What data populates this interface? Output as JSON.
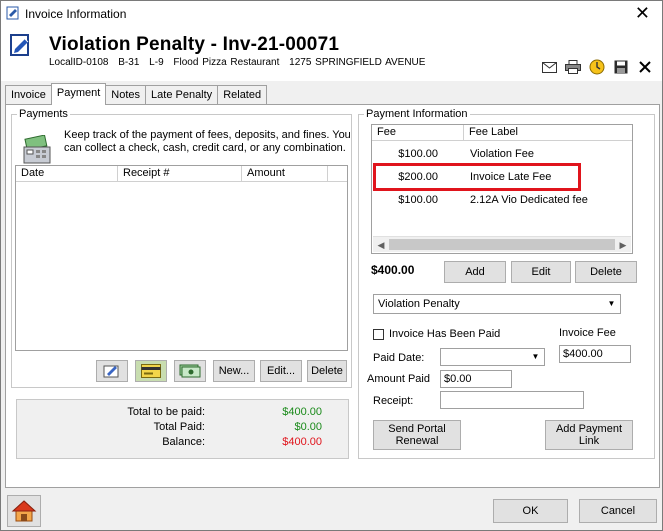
{
  "window": {
    "title": "Invoice Information",
    "close_glyph": "✕"
  },
  "header": {
    "title": "Violation Penalty - Inv-21-00071",
    "local_id": "LocalID-0108",
    "code1": "B-31",
    "code2": "L-9",
    "business": "Flood Pizza Restaurant",
    "address": "1275 SPRINGFIELD AVENUE",
    "icons": [
      "envelope-icon",
      "printer-icon",
      "clock-icon",
      "save-icon",
      "close-icon"
    ]
  },
  "tabs": [
    {
      "label": "Invoice",
      "active": false
    },
    {
      "label": "Payment",
      "active": true
    },
    {
      "label": "Notes",
      "active": false
    },
    {
      "label": "Late Penalty",
      "active": false
    },
    {
      "label": "Related",
      "active": false
    }
  ],
  "payments": {
    "group_label": "Payments",
    "description": "Keep track of the payment of fees, deposits, and fines. You can collect a check, cash, credit card, or any combination.",
    "columns": [
      "Date",
      "Receipt #",
      "Amount"
    ],
    "rows": [],
    "buttons": {
      "new": "New...",
      "edit": "Edit...",
      "delete": "Delete"
    }
  },
  "totals": {
    "to_be_paid_label": "Total to be paid:",
    "to_be_paid_value": "$400.00",
    "paid_label": "Total Paid:",
    "paid_value": "$0.00",
    "balance_label": "Balance:",
    "balance_value": "$400.00",
    "colors": {
      "green": "#1a8a1a",
      "red": "#e0141c"
    }
  },
  "payment_info": {
    "group_label": "Payment Information",
    "columns": [
      "Fee",
      "Fee Label"
    ],
    "rows": [
      {
        "fee": "$100.00",
        "label": "Violation Fee"
      },
      {
        "fee": "$200.00",
        "label": "Invoice Late Fee"
      },
      {
        "fee": "$100.00",
        "label": "2.12A Vio Dedicated fee"
      }
    ],
    "highlighted_row": 1,
    "highlight_color": "#e0141c",
    "total": "$400.00",
    "buttons": {
      "add": "Add",
      "edit": "Edit",
      "delete": "Delete"
    },
    "type_select": "Violation Penalty",
    "invoice_paid_label": "Invoice Has Been Paid",
    "invoice_paid_checked": false,
    "invoice_fee_label": "Invoice Fee",
    "invoice_fee_value": "$400.00",
    "paid_date_label": "Paid Date:",
    "paid_date_value": "",
    "amount_paid_label": "Amount Paid",
    "amount_paid_value": "$0.00",
    "receipt_label": "Receipt:",
    "receipt_value": "",
    "send_portal_label": "Send Portal Renewal",
    "add_payment_link_label": "Add Payment Link"
  },
  "footer": {
    "ok": "OK",
    "cancel": "Cancel"
  }
}
